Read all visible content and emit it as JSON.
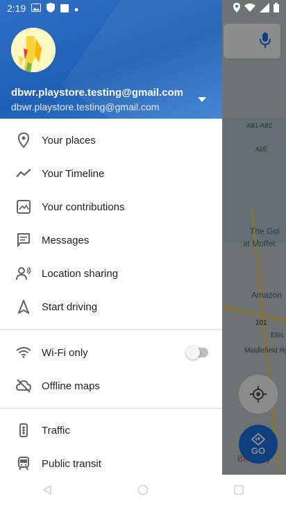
{
  "status_bar": {
    "time": "2:19"
  },
  "account": {
    "name": "dbwr.playstore.testing@gmail.com",
    "email": "dbwr.playstore.testing@gmail.com"
  },
  "menu": {
    "your_places": "Your places",
    "your_timeline": "Your Timeline",
    "your_contributions": "Your contributions",
    "messages": "Messages",
    "location_sharing": "Location sharing",
    "start_driving": "Start driving",
    "wifi_only": "Wi-Fi only",
    "offline_maps": "Offline maps",
    "traffic": "Traffic",
    "public_transit": "Public transit"
  },
  "wifi_only_enabled": false,
  "map": {
    "labels": [
      "The Gol",
      "at Moffet",
      "Amazon",
      "Middlefield Rd",
      "Ellis St",
      "Best Buy"
    ],
    "shields": [
      "AB1-AB2",
      "A2E",
      "101"
    ],
    "go_label": "GO"
  },
  "colors": {
    "header": "#1f5fb4",
    "accent": "#1a73e8"
  }
}
